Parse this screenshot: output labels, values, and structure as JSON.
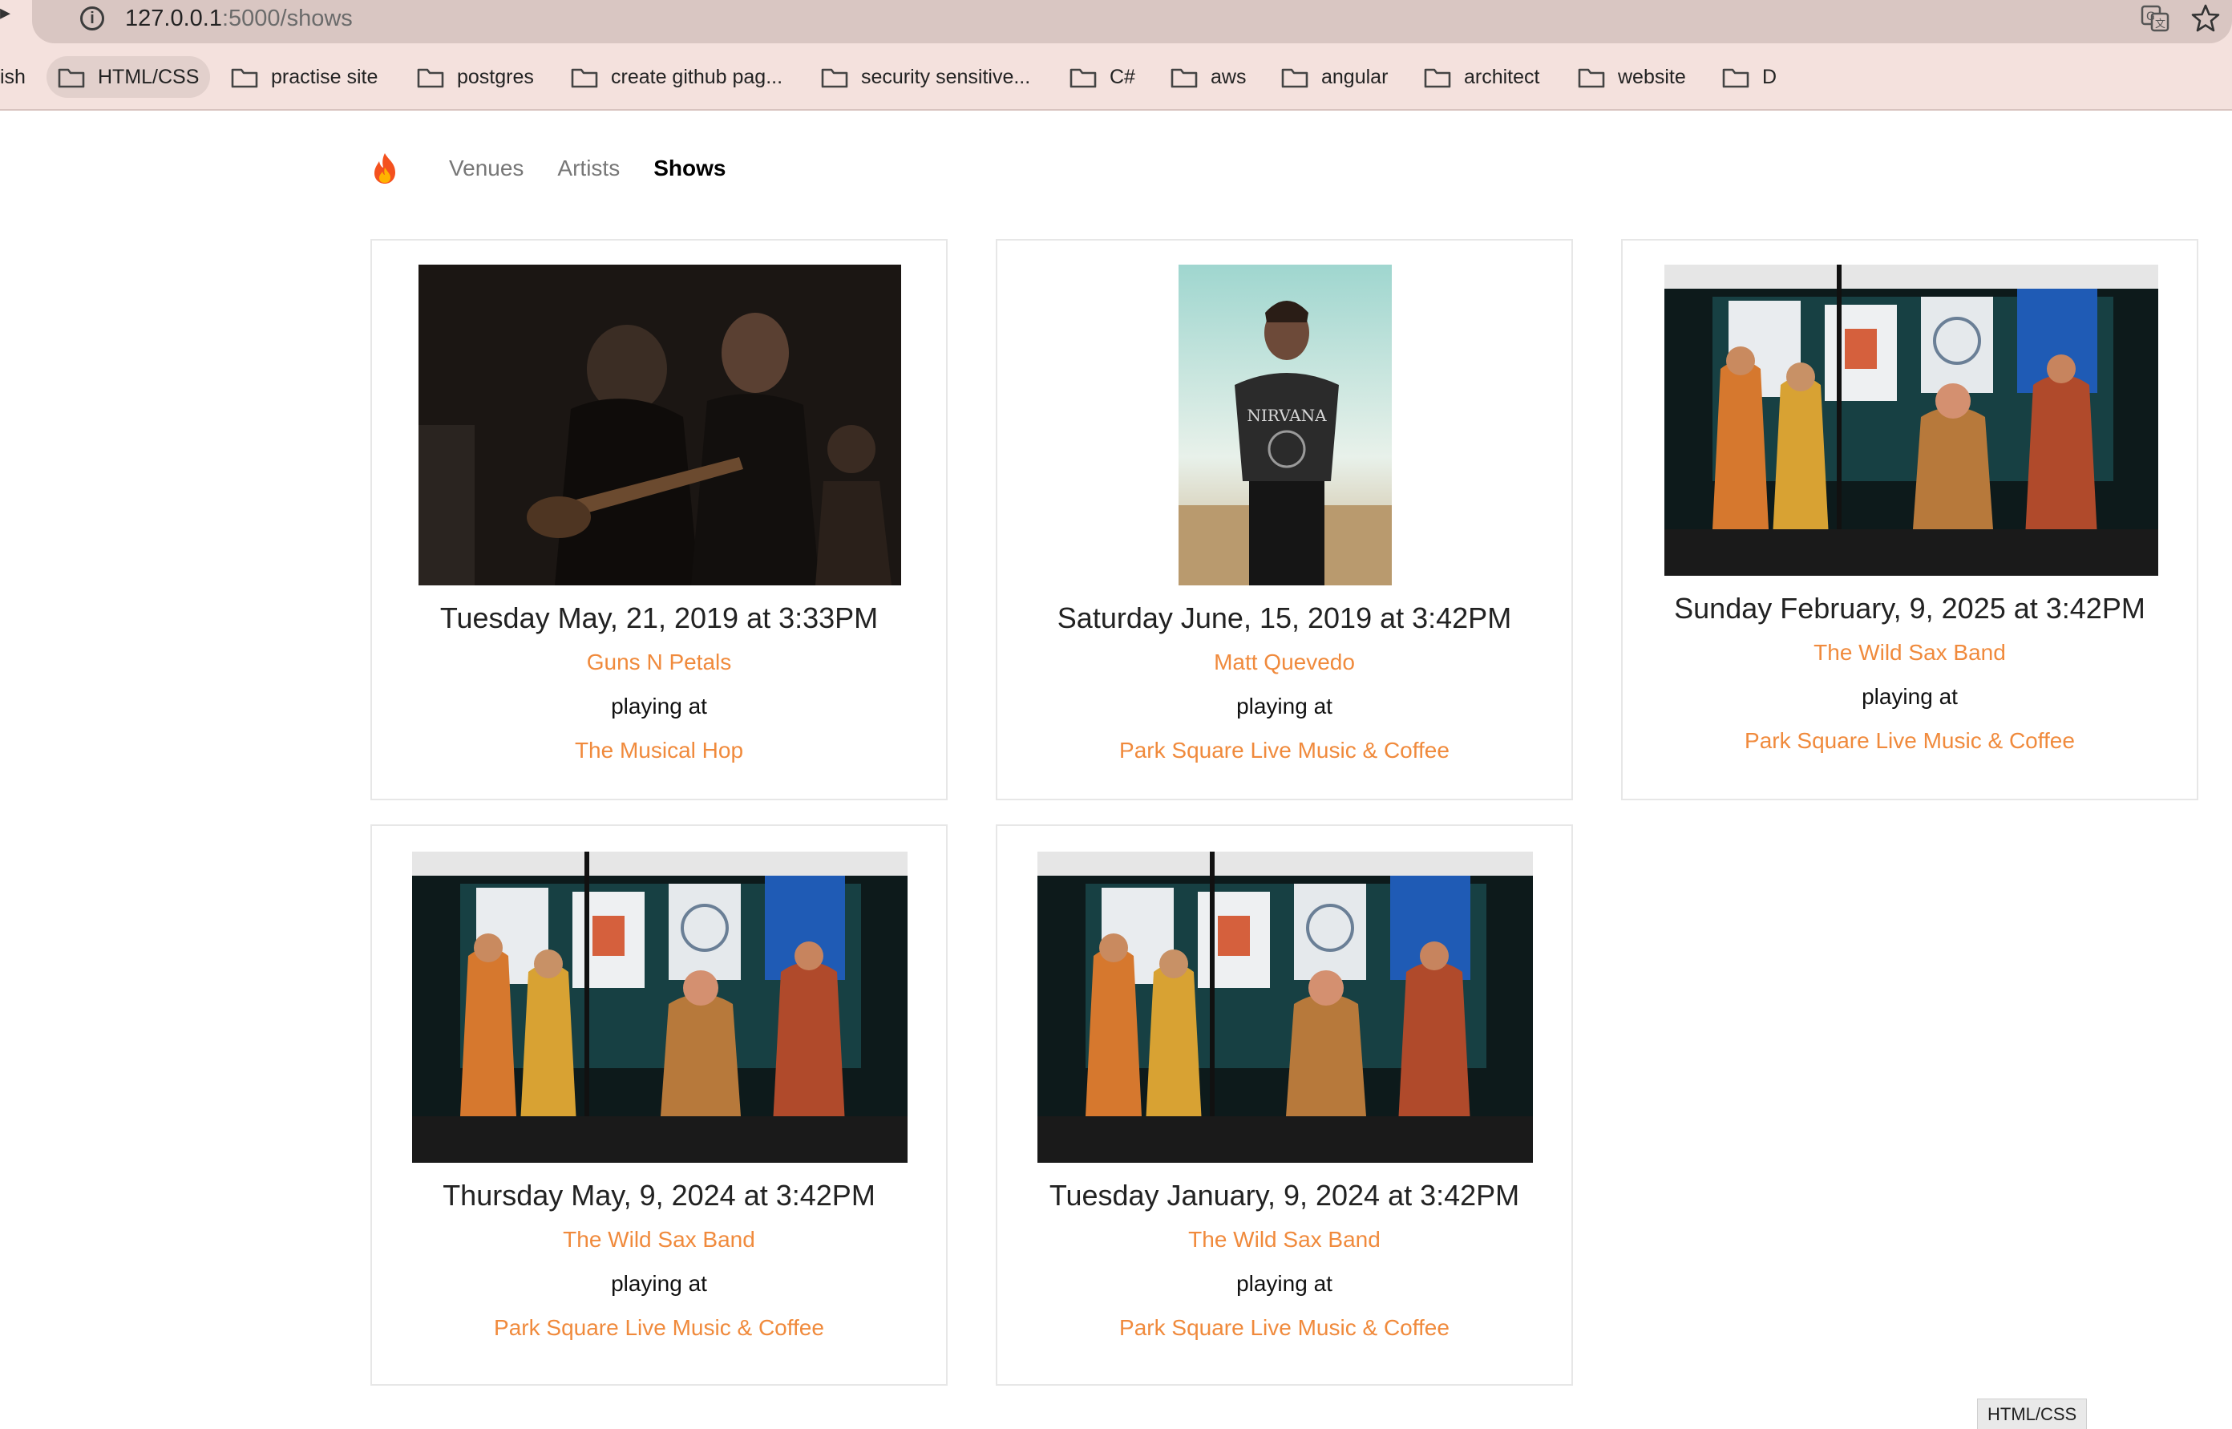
{
  "browser": {
    "url_host": "127.0.0.1",
    "url_path": ":5000/shows",
    "bookmarks": [
      {
        "label": "ish"
      },
      {
        "label": "HTML/CSS"
      },
      {
        "label": "practise site"
      },
      {
        "label": "postgres"
      },
      {
        "label": "create github pag..."
      },
      {
        "label": "security sensitive..."
      },
      {
        "label": "C#"
      },
      {
        "label": "aws"
      },
      {
        "label": "angular"
      },
      {
        "label": "architect"
      },
      {
        "label": "website"
      },
      {
        "label": "D"
      }
    ],
    "status_tooltip": "HTML/CSS"
  },
  "nav": {
    "brand_icon": "flame-icon",
    "links": [
      {
        "label": "Venues"
      },
      {
        "label": "Artists"
      },
      {
        "label": "Shows",
        "active": true
      }
    ]
  },
  "shows": [
    {
      "date": "Tuesday May, 21, 2019 at 3:33PM",
      "artist": "Guns N Petals",
      "playing_at": "playing at",
      "venue": "The Musical Hop",
      "image": "band-playing-guitar-dark-photo"
    },
    {
      "date": "Saturday June, 15, 2019 at 3:42PM",
      "artist": "Matt Quevedo",
      "playing_at": "playing at",
      "venue": "Park Square Live Music & Coffee",
      "image": "man-in-nirvana-shirt-photo"
    },
    {
      "date": "Sunday February, 9, 2025 at 3:42PM",
      "artist": "The Wild Sax Band",
      "playing_at": "playing at",
      "venue": "Park Square Live Music & Coffee",
      "image": "folk-band-on-stage-photo"
    },
    {
      "date": "Thursday May, 9, 2024 at 3:42PM",
      "artist": "The Wild Sax Band",
      "playing_at": "playing at",
      "venue": "Park Square Live Music & Coffee",
      "image": "folk-band-on-stage-photo"
    },
    {
      "date": "Tuesday January, 9, 2024 at 3:42PM",
      "artist": "The Wild Sax Band",
      "playing_at": "playing at",
      "venue": "Park Square Live Music & Coffee",
      "image": "folk-band-on-stage-photo"
    }
  ],
  "colors": {
    "link_orange": "#f08a3c",
    "chrome_bg": "#f4e1dd",
    "urlbar_bg": "#d9c6c2"
  }
}
